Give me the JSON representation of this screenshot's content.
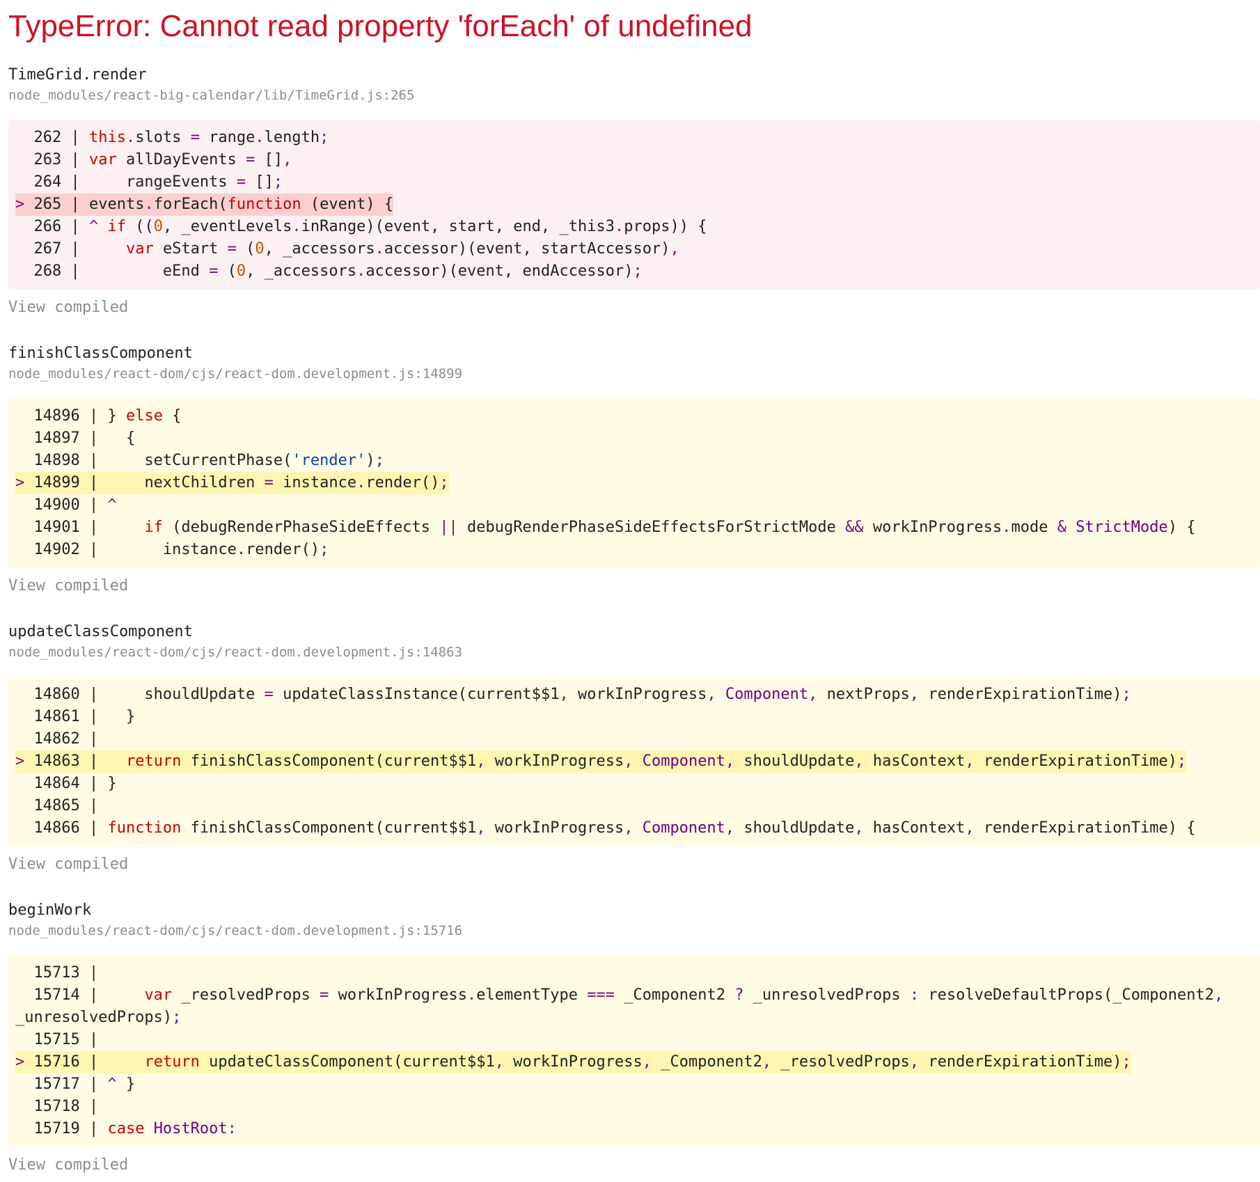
{
  "error_title": "TypeError: Cannot read property 'forEach' of undefined",
  "view_compiled_label": "View compiled",
  "frames": [
    {
      "function": "TimeGrid.render",
      "file": "node_modules/react-big-calendar/lib/TimeGrid.js:265",
      "lines": [
        [
          {
            "t": "  262 | "
          },
          {
            "t": "this",
            "c": "kw"
          },
          {
            "t": ".",
            "c": "op"
          },
          {
            "t": "slots "
          },
          {
            "t": "=",
            "c": "op"
          },
          {
            "t": " range"
          },
          {
            "t": ".",
            "c": "op"
          },
          {
            "t": "length"
          },
          {
            "t": ";",
            "c": "op"
          }
        ],
        [
          {
            "t": "  263 | "
          },
          {
            "t": "var",
            "c": "kw"
          },
          {
            "t": " allDayEvents "
          },
          {
            "t": "=",
            "c": "op"
          },
          {
            "t": " []"
          },
          {
            "t": ",",
            "c": "op"
          }
        ],
        [
          {
            "t": "  264 |     rangeEvents "
          },
          {
            "t": "=",
            "c": "op"
          },
          {
            "t": " []"
          },
          {
            "t": ";",
            "c": "op"
          }
        ],
        [
          {
            "t": "> ",
            "c": "op"
          },
          {
            "t": "265 | events"
          },
          {
            "t": ".",
            "c": "op"
          },
          {
            "t": "forEach("
          },
          {
            "t": "function",
            "c": "kw"
          },
          {
            "t": " (event) {"
          }
        ],
        [
          {
            "t": "  266 | "
          },
          {
            "t": "^",
            "c": "op"
          },
          {
            "t": " "
          },
          {
            "t": "if",
            "c": "kw"
          },
          {
            "t": " (("
          },
          {
            "t": "0",
            "c": "num"
          },
          {
            "t": ", _eventLevels"
          },
          {
            "t": ".",
            "c": "op"
          },
          {
            "t": "inRange)(event, start, end, _this3"
          },
          {
            "t": ".",
            "c": "op"
          },
          {
            "t": "props)) {"
          }
        ],
        [
          {
            "t": "  267 |     "
          },
          {
            "t": "var",
            "c": "kw"
          },
          {
            "t": " eStart "
          },
          {
            "t": "=",
            "c": "op"
          },
          {
            "t": " ("
          },
          {
            "t": "0",
            "c": "num"
          },
          {
            "t": ", _accessors"
          },
          {
            "t": ".",
            "c": "op"
          },
          {
            "t": "accessor)(event, startAccessor)"
          },
          {
            "t": ",",
            "c": "op"
          }
        ],
        [
          {
            "t": "  268 |         eEnd "
          },
          {
            "t": "=",
            "c": "op"
          },
          {
            "t": " ("
          },
          {
            "t": "0",
            "c": "num"
          },
          {
            "t": ", _accessors"
          },
          {
            "t": ".",
            "c": "op"
          },
          {
            "t": "accessor)(event, endAccessor)"
          },
          {
            "t": ";",
            "c": "op"
          }
        ]
      ]
    },
    {
      "function": "finishClassComponent",
      "file": "node_modules/react-dom/cjs/react-dom.development.js:14899",
      "lines": [
        [
          {
            "t": "  14896 | } "
          },
          {
            "t": "else",
            "c": "kw"
          },
          {
            "t": " {"
          }
        ],
        [
          {
            "t": "  14897 |   {"
          }
        ],
        [
          {
            "t": "  14898 |     setCurrentPhase("
          },
          {
            "t": "'render'",
            "c": "str"
          },
          {
            "t": ")"
          },
          {
            "t": ";",
            "c": "op"
          }
        ],
        [
          {
            "t": "> ",
            "c": "op"
          },
          {
            "t": "14899 |     nextChildren "
          },
          {
            "t": "=",
            "c": "op"
          },
          {
            "t": " instance"
          },
          {
            "t": ".",
            "c": "op"
          },
          {
            "t": "render()"
          },
          {
            "t": ";",
            "c": "op"
          }
        ],
        [
          {
            "t": "  14900 | "
          },
          {
            "t": "^",
            "c": "op"
          }
        ],
        [
          {
            "t": "  14901 |     "
          },
          {
            "t": "if",
            "c": "kw"
          },
          {
            "t": " (debugRenderPhaseSideEffects "
          },
          {
            "t": "||",
            "c": "op"
          },
          {
            "t": " debugRenderPhaseSideEffectsForStrictMode "
          },
          {
            "t": "&&",
            "c": "op"
          },
          {
            "t": " workInProgress"
          },
          {
            "t": ".",
            "c": "op"
          },
          {
            "t": "mode "
          },
          {
            "t": "&",
            "c": "op"
          },
          {
            "t": " "
          },
          {
            "t": "StrictMode",
            "c": "cls"
          },
          {
            "t": ") {"
          }
        ],
        [
          {
            "t": "  14902 |       instance"
          },
          {
            "t": ".",
            "c": "op"
          },
          {
            "t": "render()"
          },
          {
            "t": ";",
            "c": "op"
          }
        ]
      ]
    },
    {
      "function": "updateClassComponent",
      "file": "node_modules/react-dom/cjs/react-dom.development.js:14863",
      "lines": [
        [
          {
            "t": "  14860 |     shouldUpdate "
          },
          {
            "t": "=",
            "c": "op"
          },
          {
            "t": " updateClassInstance(current$$1"
          },
          {
            "t": ",",
            "c": "op"
          },
          {
            "t": " workInProgress"
          },
          {
            "t": ",",
            "c": "op"
          },
          {
            "t": " "
          },
          {
            "t": "Component",
            "c": "cls"
          },
          {
            "t": ",",
            "c": "op"
          },
          {
            "t": " nextProps"
          },
          {
            "t": ",",
            "c": "op"
          },
          {
            "t": " renderExpirationTime)"
          },
          {
            "t": ";",
            "c": "op"
          }
        ],
        [
          {
            "t": "  14861 |   }"
          }
        ],
        [
          {
            "t": "  14862 |"
          }
        ],
        [
          {
            "t": "> ",
            "c": "op"
          },
          {
            "t": "14863 |   "
          },
          {
            "t": "return",
            "c": "kw"
          },
          {
            "t": " finishClassComponent(current$$1"
          },
          {
            "t": ",",
            "c": "op"
          },
          {
            "t": " workInProgress"
          },
          {
            "t": ",",
            "c": "op"
          },
          {
            "t": " "
          },
          {
            "t": "Component",
            "c": "cls"
          },
          {
            "t": ",",
            "c": "op"
          },
          {
            "t": " shouldUpdate"
          },
          {
            "t": ",",
            "c": "op"
          },
          {
            "t": " hasContext"
          },
          {
            "t": ",",
            "c": "op"
          },
          {
            "t": " renderExpirationTime)"
          },
          {
            "t": ";",
            "c": "op"
          }
        ],
        [
          {
            "t": "  14864 | }"
          }
        ],
        [
          {
            "t": "  14865 |"
          }
        ],
        [
          {
            "t": "  14866 | "
          },
          {
            "t": "function",
            "c": "kw"
          },
          {
            "t": " finishClassComponent(current$$1"
          },
          {
            "t": ",",
            "c": "op"
          },
          {
            "t": " workInProgress"
          },
          {
            "t": ",",
            "c": "op"
          },
          {
            "t": " "
          },
          {
            "t": "Component",
            "c": "cls"
          },
          {
            "t": ",",
            "c": "op"
          },
          {
            "t": " shouldUpdate"
          },
          {
            "t": ",",
            "c": "op"
          },
          {
            "t": " hasContext"
          },
          {
            "t": ",",
            "c": "op"
          },
          {
            "t": " renderExpirationTime) {"
          }
        ]
      ]
    },
    {
      "function": "beginWork",
      "file": "node_modules/react-dom/cjs/react-dom.development.js:15716",
      "lines": [
        [
          {
            "t": "  15713 |"
          }
        ],
        [
          {
            "t": "  15714 |     "
          },
          {
            "t": "var",
            "c": "kw"
          },
          {
            "t": " _resolvedProps "
          },
          {
            "t": "=",
            "c": "op"
          },
          {
            "t": " workInProgress"
          },
          {
            "t": ".",
            "c": "op"
          },
          {
            "t": "elementType "
          },
          {
            "t": "===",
            "c": "op"
          },
          {
            "t": " _Component2 "
          },
          {
            "t": "?",
            "c": "op"
          },
          {
            "t": " _unresolvedProps "
          },
          {
            "t": ":",
            "c": "op"
          },
          {
            "t": " resolveDefaultProps(_Component2"
          },
          {
            "t": ",",
            "c": "op"
          }
        ],
        [
          {
            "t": "_unresolvedProps)"
          },
          {
            "t": ";",
            "c": "op"
          }
        ],
        [
          {
            "t": "  15715 |"
          }
        ],
        [
          {
            "t": "> ",
            "c": "op"
          },
          {
            "t": "15716 |     "
          },
          {
            "t": "return",
            "c": "kw"
          },
          {
            "t": " updateClassComponent(current$$1"
          },
          {
            "t": ",",
            "c": "op"
          },
          {
            "t": " workInProgress"
          },
          {
            "t": ",",
            "c": "op"
          },
          {
            "t": " _Component2"
          },
          {
            "t": ",",
            "c": "op"
          },
          {
            "t": " _resolvedProps"
          },
          {
            "t": ",",
            "c": "op"
          },
          {
            "t": " renderExpirationTime)"
          },
          {
            "t": ";",
            "c": "op"
          }
        ],
        [
          {
            "t": "  15717 | "
          },
          {
            "t": "^",
            "c": "op"
          },
          {
            "t": " }"
          }
        ],
        [
          {
            "t": "  15718 |"
          }
        ],
        [
          {
            "t": "  15719 | "
          },
          {
            "t": "case",
            "c": "kw"
          },
          {
            "t": " "
          },
          {
            "t": "HostRoot",
            "c": "cls"
          },
          {
            "t": ":",
            "c": "op"
          }
        ]
      ]
    }
  ]
}
